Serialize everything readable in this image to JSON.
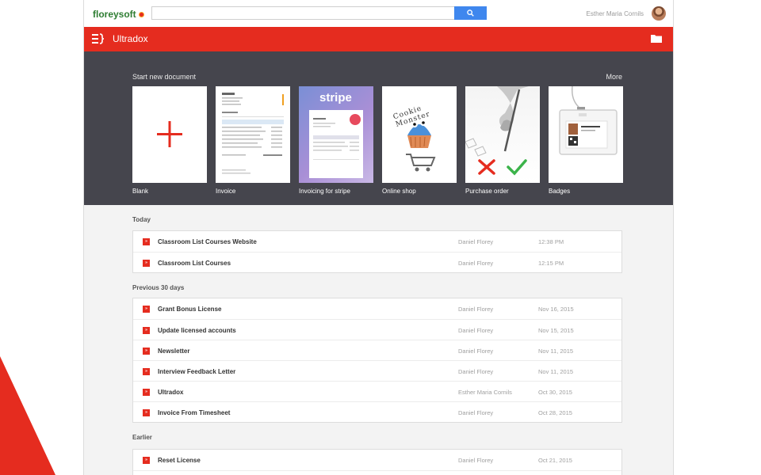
{
  "brand": {
    "name_part1": "floreysoft",
    "name_part2": ""
  },
  "search": {
    "placeholder": ""
  },
  "user": {
    "name": "Esther Maria Cornils"
  },
  "app": {
    "title": "Ultradox"
  },
  "templates": {
    "title": "Start new document",
    "more": "More",
    "items": [
      {
        "label": "Blank"
      },
      {
        "label": "Invoice"
      },
      {
        "label": "Invoicing for stripe",
        "thumb_text": "stripe"
      },
      {
        "label": "Online shop",
        "thumb_text": "Cookie Monster"
      },
      {
        "label": "Purchase order"
      },
      {
        "label": "Badges"
      }
    ]
  },
  "sections": {
    "today": {
      "title": "Today",
      "rows": [
        {
          "name": "Classroom List Courses Website",
          "owner": "Daniel Florey",
          "date": "12:38 PM"
        },
        {
          "name": "Classroom List Courses",
          "owner": "Daniel Florey",
          "date": "12:15 PM"
        }
      ]
    },
    "previous": {
      "title": "Previous 30 days",
      "rows": [
        {
          "name": "Grant Bonus License",
          "owner": "Daniel Florey",
          "date": "Nov 16, 2015"
        },
        {
          "name": "Update licensed accounts",
          "owner": "Daniel Florey",
          "date": "Nov 15, 2015"
        },
        {
          "name": "Newsletter",
          "owner": "Daniel Florey",
          "date": "Nov 11, 2015"
        },
        {
          "name": "Interview Feedback Letter",
          "owner": "Daniel Florey",
          "date": "Nov 11, 2015"
        },
        {
          "name": "Ultradox",
          "owner": "Esther Maria Cornils",
          "date": "Oct 30, 2015"
        },
        {
          "name": "Invoice From Timesheet",
          "owner": "Daniel Florey",
          "date": "Oct 28, 2015"
        }
      ]
    },
    "earlier": {
      "title": "Earlier",
      "rows": [
        {
          "name": "Reset License",
          "owner": "Daniel Florey",
          "date": "Oct 21, 2015"
        }
      ]
    }
  },
  "icons": {
    "doc": "document-icon",
    "doc_glyph": "»"
  },
  "colors": {
    "accent": "#e52c1f",
    "panel": "#45454d",
    "search": "#3f87ee"
  }
}
